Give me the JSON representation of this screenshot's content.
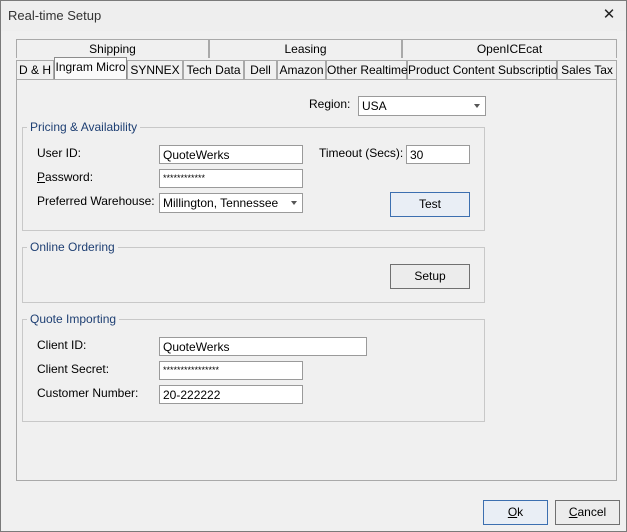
{
  "window": {
    "title": "Real-time Setup",
    "close_glyph": "✕"
  },
  "tabs_top": [
    {
      "label": "Shipping"
    },
    {
      "label": "Leasing"
    },
    {
      "label": "OpenICEcat"
    }
  ],
  "tabs_bottom": [
    {
      "label": "D & H"
    },
    {
      "label": "Ingram Micro",
      "active": true
    },
    {
      "label": "SYNNEX"
    },
    {
      "label": "Tech Data"
    },
    {
      "label": "Dell"
    },
    {
      "label": "Amazon"
    },
    {
      "label": "Other Realtime"
    },
    {
      "label": "Product Content Subscription"
    },
    {
      "label": "Sales Tax"
    }
  ],
  "region": {
    "label": "Region:",
    "value": "USA"
  },
  "pricing": {
    "title": "Pricing & Availability",
    "user_id_label": "User ID:",
    "user_id_value": "QuoteWerks",
    "password_label_rest": "assword:",
    "password_label_underlined": "P",
    "password_value": "************",
    "warehouse_label": "Preferred Warehouse:",
    "warehouse_value": "Millington, Tennessee",
    "timeout_label": "Timeout (Secs):",
    "timeout_value": "30",
    "test_button": "Test"
  },
  "ordering": {
    "title": "Online Ordering",
    "setup_button": "Setup"
  },
  "importing": {
    "title": "Quote Importing",
    "client_id_label": "Client ID:",
    "client_id_value": "QuoteWerks",
    "client_secret_label": "Client Secret:",
    "client_secret_value": "****************",
    "customer_number_label": "Customer Number:",
    "customer_number_value": "20-222222"
  },
  "footer": {
    "ok_underlined": "O",
    "ok_rest": "k",
    "cancel_underlined": "C",
    "cancel_rest": "ancel"
  }
}
